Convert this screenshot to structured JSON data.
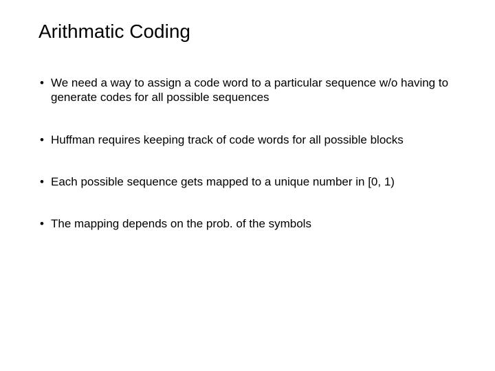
{
  "title": "Arithmatic Coding",
  "bullets": [
    " We need a way to assign a code word to a particular sequence w/o having to generate codes for all possible sequences",
    " Huffman requires keeping track of code words for all possible blocks",
    " Each possible sequence gets mapped to a unique number in [0, 1)",
    " The mapping depends on the prob. of the symbols"
  ]
}
